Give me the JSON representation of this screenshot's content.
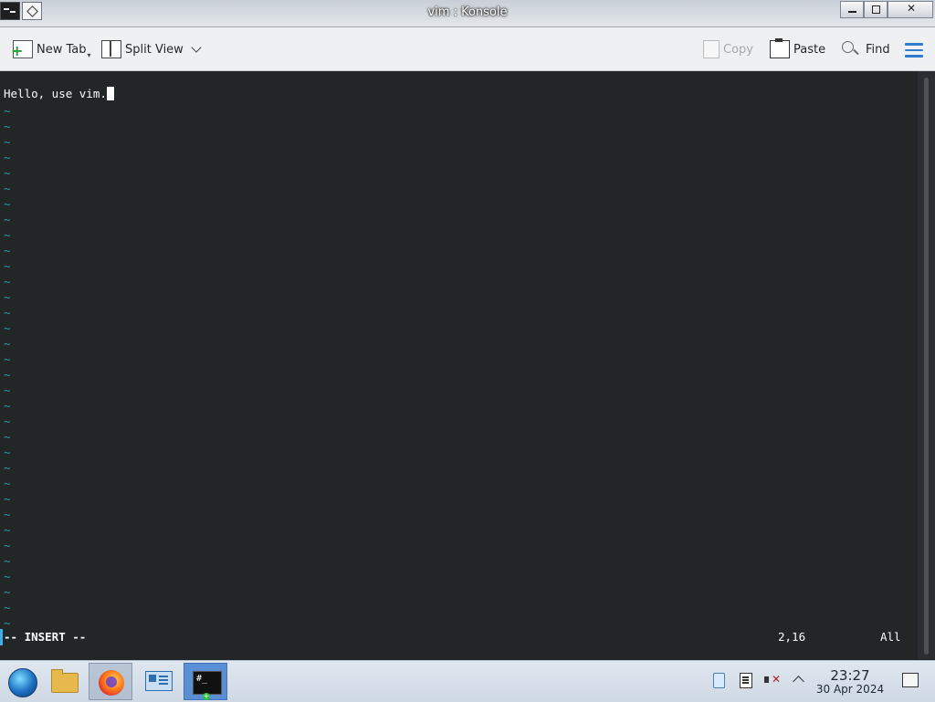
{
  "window": {
    "title": "vim : Konsole"
  },
  "toolbar": {
    "new_tab": "New Tab",
    "split_view": "Split View",
    "copy": "Copy",
    "paste": "Paste",
    "find": "Find"
  },
  "terminal": {
    "text_line": "Hello, use vim.",
    "tilde": "~",
    "mode": "-- INSERT --",
    "position": "2,16",
    "scroll": "All"
  },
  "taskbar": {
    "time": "23:27",
    "date": "30 Apr 2024"
  },
  "colors": {
    "terminal_bg": "#232627",
    "tilde": "#1fa0a8",
    "accent": "#3daee9"
  }
}
